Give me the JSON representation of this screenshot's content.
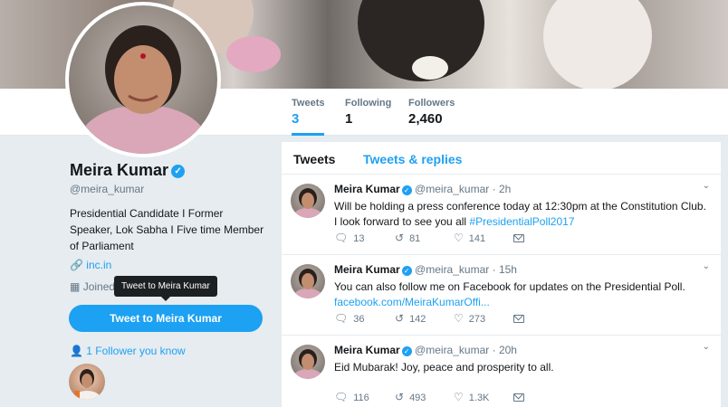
{
  "profile_nav": {
    "stats": [
      {
        "label": "Tweets",
        "value": "3"
      },
      {
        "label": "Following",
        "value": "1"
      },
      {
        "label": "Followers",
        "value": "2,460"
      }
    ]
  },
  "profile": {
    "name": "Meira Kumar",
    "handle": "@meira_kumar",
    "bio": "Presidential Candidate I Former Speaker, Lok Sabha I Five time Member of Parliament",
    "link": "inc.in",
    "joined": "Joined",
    "tooltip": "Tweet to Meira Kumar",
    "tweet_to_button": "Tweet to Meira Kumar",
    "followers_you_know": "1 Follower you know"
  },
  "timeline": {
    "tabs": [
      "Tweets",
      "Tweets & replies"
    ],
    "tweets": [
      {
        "name": "Meira Kumar",
        "handle": "@meira_kumar",
        "time": "2h",
        "text": "Will be holding a press conference today at 12:30pm at the Constitution Club. I look forward to see you all ",
        "hashtag": "#PresidentialPoll2017",
        "link": "",
        "replies": "13",
        "retweets": "81",
        "likes": "141"
      },
      {
        "name": "Meira Kumar",
        "handle": "@meira_kumar",
        "time": "15h",
        "text": "You can also follow me on Facebook for updates on the Presidential Poll.",
        "hashtag": "",
        "link": "facebook.com/MeiraKumarOffi...",
        "replies": "36",
        "retweets": "142",
        "likes": "273"
      },
      {
        "name": "Meira Kumar",
        "handle": "@meira_kumar",
        "time": "20h",
        "text": "Eid Mubarak! Joy, peace and prosperity to all.",
        "hashtag": "",
        "link": "",
        "replies": "116",
        "retweets": "493",
        "likes": "1.3K"
      }
    ]
  },
  "colors": {
    "accent": "#1da1f2",
    "background": "#e6ecf0",
    "text": "#14171a",
    "muted": "#657786"
  },
  "icons": [
    "verified-badge-icon",
    "link-icon",
    "calendar-icon",
    "person-icon",
    "reply-icon",
    "retweet-icon",
    "like-icon",
    "message-icon",
    "chevron-down-icon"
  ]
}
